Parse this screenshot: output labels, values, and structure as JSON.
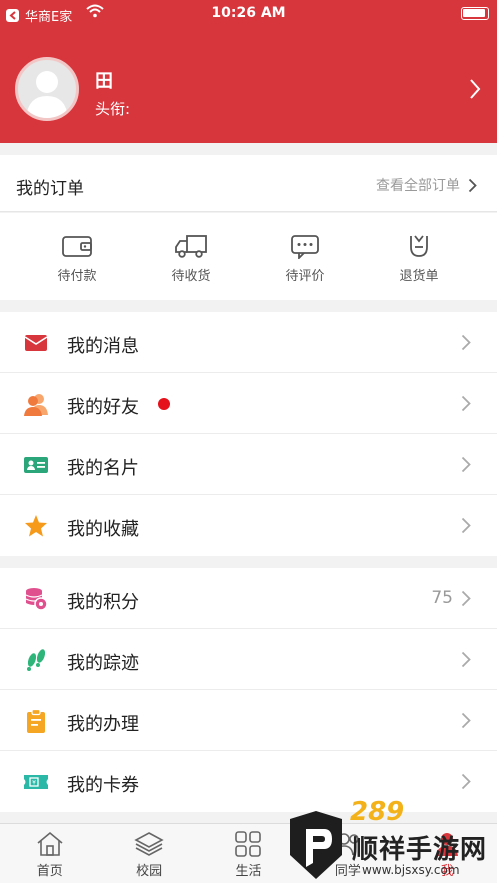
{
  "status_bar": {
    "back_app": "华商E家",
    "time": "10:26 AM"
  },
  "profile": {
    "name": "田",
    "title_label": "头衔:"
  },
  "orders": {
    "title": "我的订单",
    "view_all": "查看全部订单",
    "items": [
      {
        "label": "待付款",
        "icon": "wallet-icon"
      },
      {
        "label": "待收货",
        "icon": "truck-icon"
      },
      {
        "label": "待评价",
        "icon": "comment-icon"
      },
      {
        "label": "退货单",
        "icon": "return-icon"
      }
    ]
  },
  "group1": [
    {
      "label": "我的消息",
      "icon": "mail-icon",
      "color": "#d8363d"
    },
    {
      "label": "我的好友",
      "icon": "friends-icon",
      "color": "#f07a3e",
      "badge": true
    },
    {
      "label": "我的名片",
      "icon": "card-icon",
      "color": "#2aa67a"
    },
    {
      "label": "我的收藏",
      "icon": "star-icon",
      "color": "#f59a1b"
    }
  ],
  "group2": [
    {
      "label": "我的积分",
      "icon": "points-icon",
      "color": "#e0508f",
      "value": "75"
    },
    {
      "label": "我的踪迹",
      "icon": "footprints-icon",
      "color": "#2db57a"
    },
    {
      "label": "我的办理",
      "icon": "clipboard-icon",
      "color": "#f5a623"
    },
    {
      "label": "我的卡券",
      "icon": "coupon-icon",
      "color": "#2bb8a6"
    }
  ],
  "tabs": [
    {
      "label": "首页",
      "icon": "home-icon"
    },
    {
      "label": "校园",
      "icon": "layers-icon"
    },
    {
      "label": "生活",
      "icon": "grid-icon"
    },
    {
      "label": "同学",
      "icon": "classmates-icon"
    },
    {
      "label": "我",
      "icon": "me-icon",
      "active": true
    }
  ],
  "watermark": {
    "brand": "顺祥手游网",
    "url": "www.bjsxsy.com",
    "numeral": "289"
  },
  "colors": {
    "primary": "#d8363d",
    "background": "#f2f2f2"
  }
}
